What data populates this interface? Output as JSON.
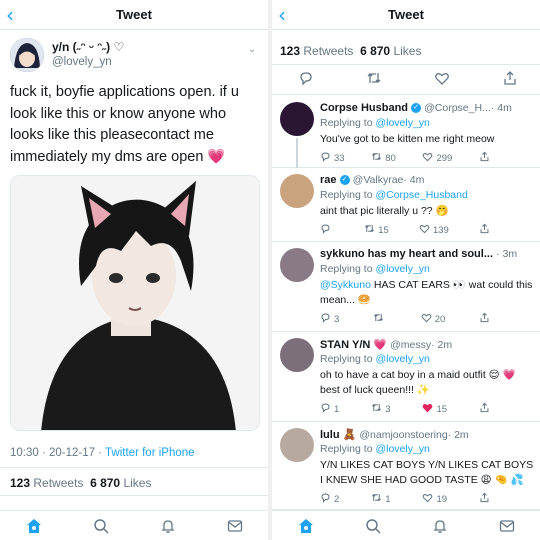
{
  "left": {
    "header": {
      "title": "Tweet"
    },
    "tweet": {
      "display_name": "y/n (˶ᵔ ᵕ ᵔ˶) ♡",
      "handle": "@lovely_yn",
      "text": "fuck it, boyfie applications open. if u look like this or know anyone who looks like this pleasecontact me immediately my dms are open 💗",
      "meta_time": "10:30 · 20-12-17 · ",
      "meta_source": "Twitter for iPhone",
      "retweets_count": "123",
      "retweets_label": "Retweets",
      "likes_count": "6 870",
      "likes_label": "Likes"
    }
  },
  "right": {
    "header": {
      "title": "Tweet"
    },
    "stats": {
      "retweets_count": "123",
      "retweets_label": "Retweets",
      "likes_count": "6 870",
      "likes_label": "Likes"
    },
    "replies": [
      {
        "name": "Corpse Husband",
        "handle": "@Corpse_H...",
        "time": "· 4m",
        "replying": "Replying to ",
        "to": "@lovely_yn",
        "text": "You've got to be kitten me right meow",
        "mention": "",
        "replies": "33",
        "retweets": "80",
        "likes": "299",
        "avatar_color": "#2a1633"
      },
      {
        "name": "rae",
        "handle": "@Valkyrae",
        "time": "· 4m",
        "replying": "Replying to ",
        "to": "@Corpse_Husband",
        "text": "aint that pic literally u ?? 🤭",
        "mention": "",
        "replies": "",
        "retweets": "15",
        "likes": "139",
        "avatar_color": "#c9a27e"
      },
      {
        "name": "sykkuno has my heart and soul...",
        "handle": "",
        "time": "· 3m",
        "replying": "Replying to ",
        "to": "@lovely_yn",
        "text": " HAS CAT EARS 👀 wat could this mean... 🥯",
        "mention": "@Sykkuno",
        "replies": "3",
        "retweets": "",
        "likes": "20",
        "avatar_color": "#8a7a86"
      },
      {
        "name": "STAN Y/N 💗",
        "handle": "@messy",
        "time": "· 2m",
        "replying": "Replying to ",
        "to": "@lovely_yn",
        "text": "oh to have a cat boy in a maid outfit 😌 💗 best of luck queen!!! ✨",
        "mention": "",
        "replies": "1",
        "retweets": "3",
        "likes": "15",
        "avatar_color": "#7b6f7a"
      },
      {
        "name": "lulu 🧸",
        "handle": "@namjoonstoering",
        "time": "· 2m",
        "replying": "Replying to ",
        "to": "@lovely_yn",
        "text": "Y/N LIKES CAT BOYS Y/N LIKES CAT BOYS I KNEW SHE HAD GOOD TASTE 😩 🤏 💦",
        "mention": "",
        "replies": "2",
        "retweets": "1",
        "likes": "19",
        "avatar_color": "#b8a9a0"
      }
    ]
  },
  "colors": {
    "accent": "#1da1f2",
    "like_red": "#e0245e",
    "verified": "#1da1f2"
  },
  "tabbar": [
    "home-icon",
    "search-icon",
    "notifications-icon",
    "messages-icon"
  ]
}
